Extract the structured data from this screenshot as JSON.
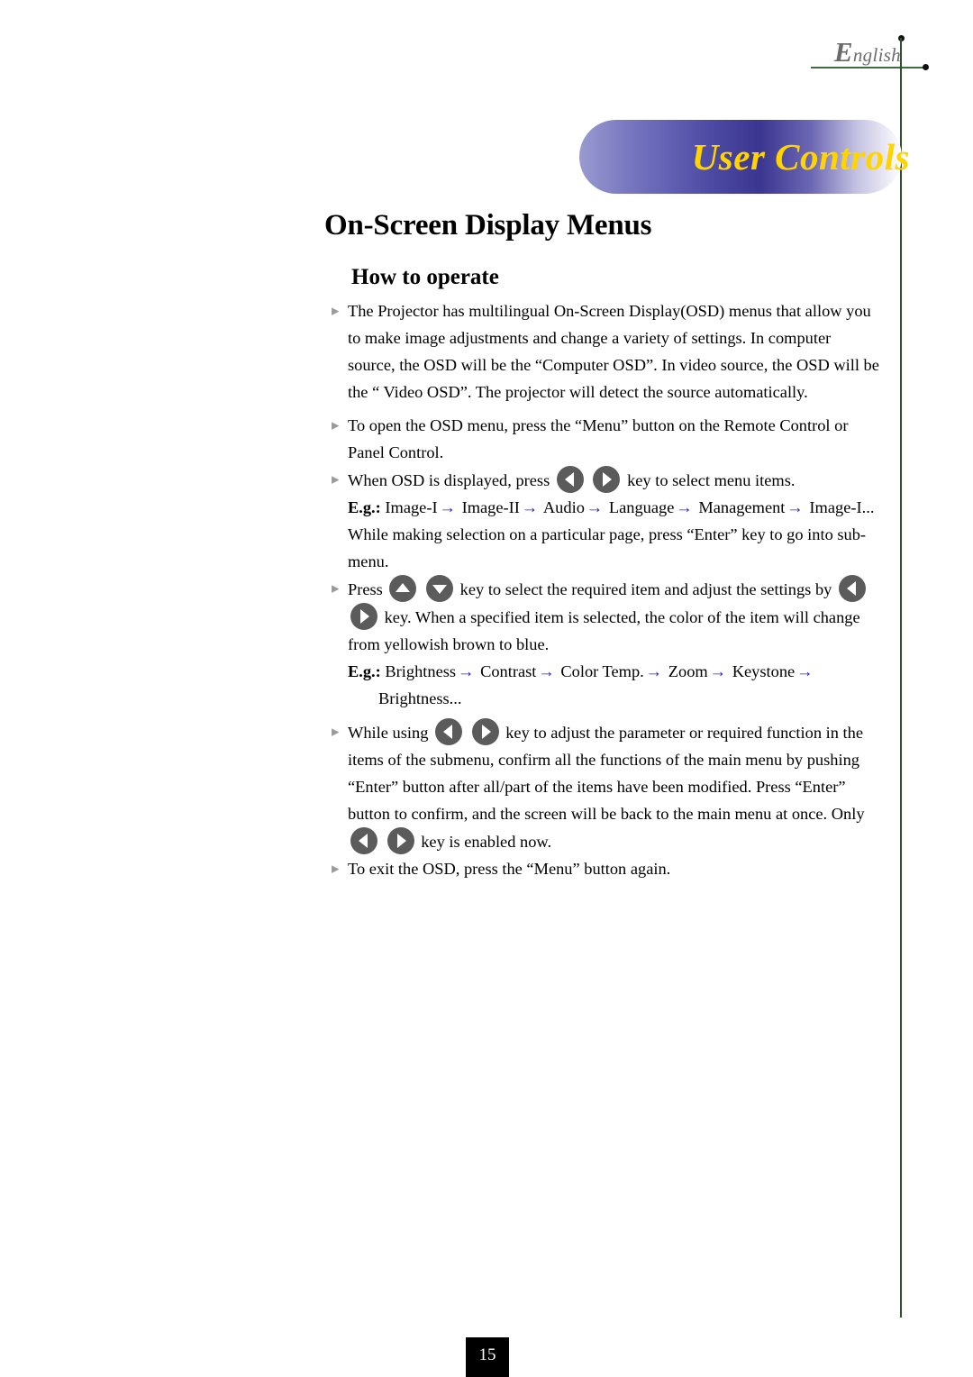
{
  "header": {
    "language_cap": "E",
    "language_rest": "nglish",
    "deco_color": "#3f6b3f"
  },
  "banner": {
    "title": "User Controls",
    "text_color": "#ffd400",
    "gradient_start": "#9a9bd0",
    "gradient_mid": "#3b3690",
    "gradient_end": "#ffffff"
  },
  "page_title": "On-Screen Display Menus",
  "section_title": "How to operate",
  "bullet_glyph": "▸",
  "arrow_glyph": "→",
  "arrow_color": "#2b2bd0",
  "body": {
    "p1_line1": "The Projector has multilingual On-Screen Display(OSD) menus that allow you",
    "p1_line2": "to make image adjustments and change a variety of settings. In computer",
    "p1_line3": "source, the OSD will be the “Computer OSD”. In video source, the OSD will be",
    "p1_line4": "the “ Video OSD”. The projector will detect the source automatically.",
    "p2_line1": "To open the OSD menu, press the “Menu” button on the Remote Control or",
    "p2_line2": "Panel Control.",
    "p3_before": "When OSD is displayed, press",
    "p3_after": "key to select menu items.",
    "eg1_label": "E.g.:",
    "eg1_items": [
      "Image-I",
      "Image-II",
      "Audio",
      "Language",
      "Management",
      "Image-I..."
    ],
    "p4_line1": "While making selection on a particular page, press “Enter” key to go into sub-",
    "p4_line2": "menu.",
    "p5_a": "Press",
    "p5_b": "key to select the required item and adjust the settings by",
    "p5_c": "key.  When a specified item is selected, the color of the item will change",
    "p5_d": "from yellowish brown to blue.",
    "eg2_label": "E.g.:",
    "eg2_items": [
      "Brightness",
      "Contrast",
      "Color Temp.",
      "Zoom",
      "Keystone"
    ],
    "eg2_tail": "Brightness...",
    "p6_a": "While using",
    "p6_b": "key to adjust the parameter or required function in the",
    "p6_line2": "items of the submenu, confirm all the functions of the main menu by pushing",
    "p6_line3": "“Enter” button after all/part of the items have been modified.  Press “Enter”",
    "p6_line4": "button to confirm, and the screen will be back to the main menu at once.  Only",
    "p6_c": "key is enabled now.",
    "p7": "To exit the OSD, press the “Menu” button again."
  },
  "footer": {
    "page_number": "15"
  }
}
